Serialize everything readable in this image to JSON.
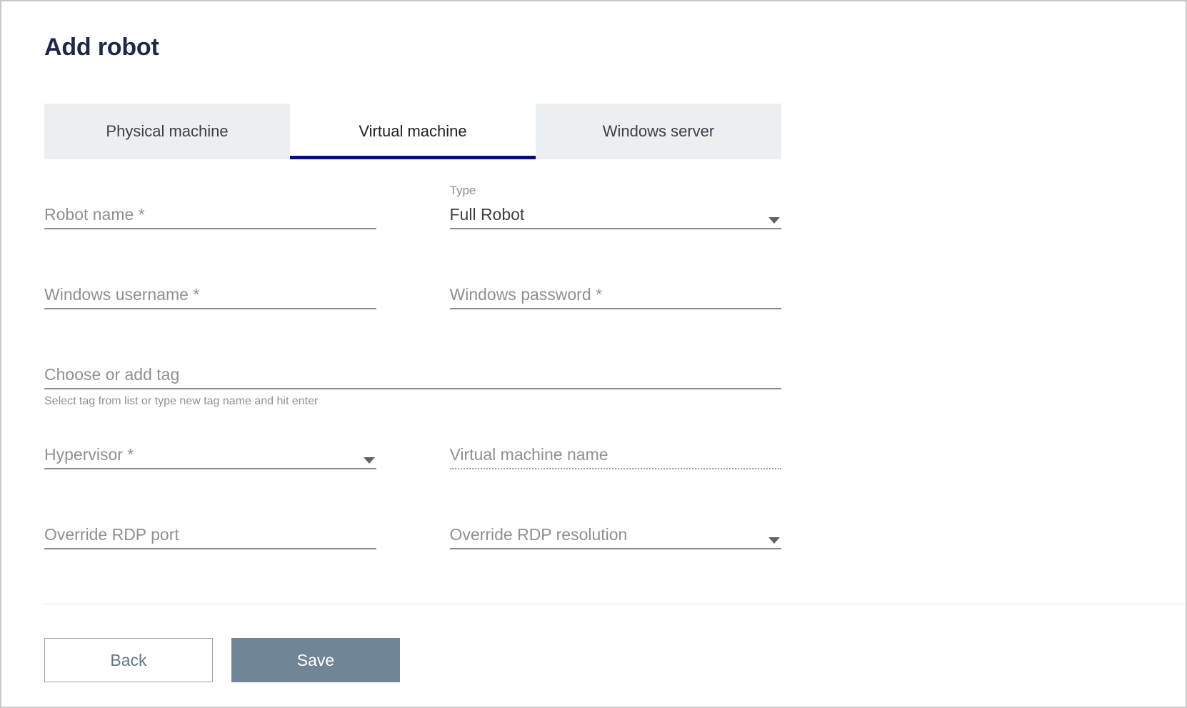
{
  "page": {
    "title": "Add robot"
  },
  "tabs": [
    {
      "label": "Physical machine",
      "active": false
    },
    {
      "label": "Virtual machine",
      "active": true
    },
    {
      "label": "Windows server",
      "active": false
    }
  ],
  "form": {
    "robot_name": {
      "placeholder": "Robot name *",
      "value": ""
    },
    "type": {
      "label": "Type",
      "value": "Full Robot",
      "icon": "chevron-down-icon"
    },
    "windows_username": {
      "placeholder": "Windows username *",
      "value": ""
    },
    "windows_password": {
      "placeholder": "Windows password *",
      "value": ""
    },
    "tag": {
      "placeholder": "Choose or add tag",
      "value": "",
      "hint": "Select tag from list or type new tag name and hit enter"
    },
    "hypervisor": {
      "placeholder": "Hypervisor *",
      "value": "",
      "icon": "chevron-down-icon"
    },
    "virtual_machine_name": {
      "placeholder": "Virtual machine name",
      "value": ""
    },
    "override_rdp_port": {
      "placeholder": "Override RDP port",
      "value": ""
    },
    "override_rdp_resolution": {
      "placeholder": "Override RDP resolution",
      "value": "",
      "icon": "chevron-down-icon"
    }
  },
  "footer": {
    "back_label": "Back",
    "save_label": "Save"
  },
  "colors": {
    "title": "#1e2749",
    "tab_active_underline": "#0a0a78",
    "tab_inactive_bg": "#eceff1",
    "save_bg": "#708596",
    "back_text": "#60788c",
    "placeholder": "#8d9194"
  }
}
